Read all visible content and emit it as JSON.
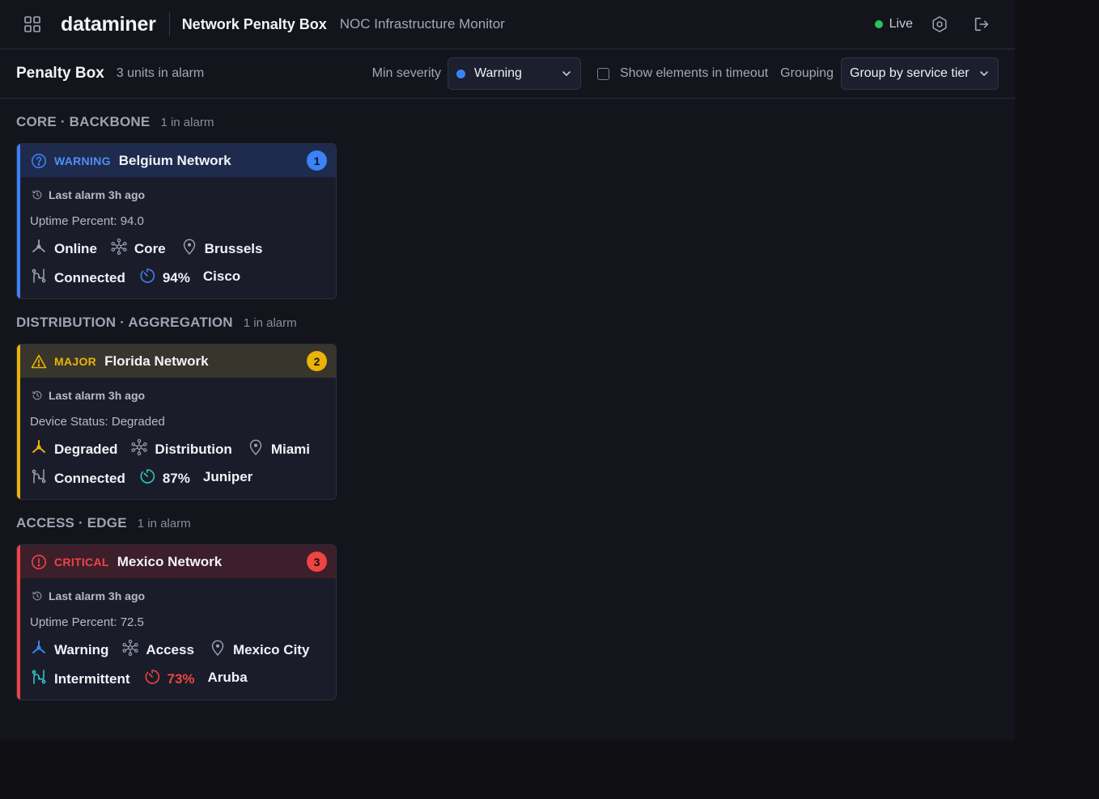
{
  "header": {
    "brand": "dataminer",
    "app_title": "Network Penalty Box",
    "app_subtitle": "NOC Infrastructure Monitor",
    "live_label": "Live"
  },
  "filterbar": {
    "title": "Penalty Box",
    "count": "3 units in alarm",
    "min_severity_label": "Min severity",
    "min_severity_value": "Warning",
    "timeout_label": "Show elements in timeout",
    "timeout_checked": false,
    "grouping_label": "Grouping",
    "grouping_value": "Group by service tier"
  },
  "groups": [
    {
      "title": "CORE · BACKBONE",
      "count": "1 in alarm",
      "card": {
        "severity": "WARNING",
        "severity_color": "#3b82f6",
        "name": "Belgium Network",
        "badge": "1",
        "last_alarm": "Last alarm 3h ago",
        "metric": "Uptime Percent: 94.0",
        "status": "Online",
        "tier": "Core",
        "location": "Brussels",
        "connection": "Connected",
        "uptime": "94%",
        "vendor": "Cisco"
      }
    },
    {
      "title": "DISTRIBUTION · AGGREGATION",
      "count": "1 in alarm",
      "card": {
        "severity": "MAJOR",
        "severity_color": "#eab308",
        "name": "Florida Network",
        "badge": "2",
        "last_alarm": "Last alarm 3h ago",
        "metric": "Device Status: Degraded",
        "status": "Degraded",
        "tier": "Distribution",
        "location": "Miami",
        "connection": "Connected",
        "uptime": "87%",
        "vendor": "Juniper"
      }
    },
    {
      "title": "ACCESS · EDGE",
      "count": "1 in alarm",
      "card": {
        "severity": "CRITICAL",
        "severity_color": "#ef4444",
        "name": "Mexico Network",
        "badge": "3",
        "last_alarm": "Last alarm 3h ago",
        "metric": "Uptime Percent: 72.5",
        "status": "Warning",
        "tier": "Access",
        "location": "Mexico City",
        "connection": "Intermittent",
        "uptime": "73%",
        "vendor": "Aruba"
      }
    }
  ]
}
